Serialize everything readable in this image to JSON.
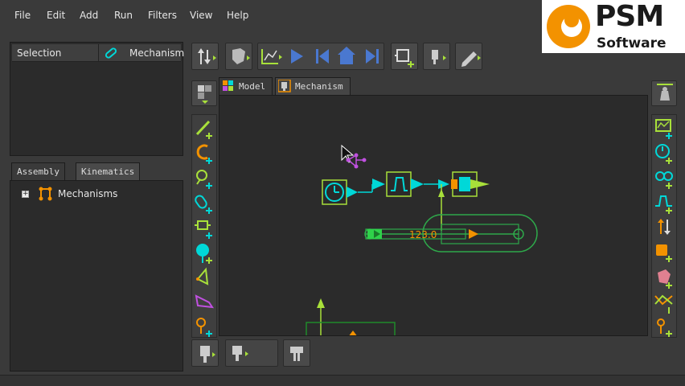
{
  "menu": {
    "file": "File",
    "edit": "Edit",
    "add": "Add",
    "run": "Run",
    "filters": "Filters",
    "view": "View",
    "help": "Help"
  },
  "logo": {
    "brand": "PSM",
    "sub": "Software"
  },
  "selection_panel": {
    "col_selection": "Selection",
    "col_mechanism": "Mechanism"
  },
  "left_tabs": {
    "assembly": "Assembly",
    "kinematics": "Kinematics"
  },
  "tree": {
    "item": "Mechanisms"
  },
  "doc_tabs": {
    "model": "Model",
    "mechanism": "Mechanism"
  },
  "canvas": {
    "slider_value": "123.0"
  },
  "colors": {
    "accent_green": "#a8e03a",
    "cyan": "#00e0e0",
    "orange": "#f39200",
    "purple": "#c050e0",
    "blue": "#4a78d0"
  }
}
